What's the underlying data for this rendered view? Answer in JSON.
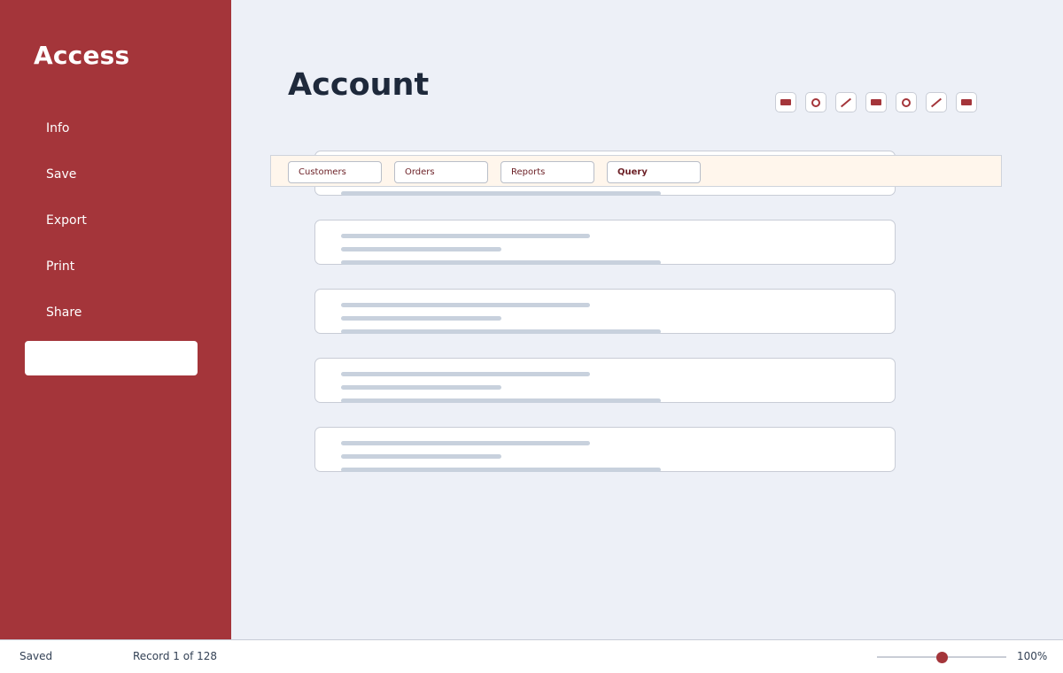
{
  "app": {
    "title": "Access"
  },
  "sidebar": {
    "items": [
      {
        "label": "Info"
      },
      {
        "label": "Save"
      },
      {
        "label": "Export"
      },
      {
        "label": "Print"
      },
      {
        "label": "Share"
      },
      {
        "label": ""
      }
    ],
    "selected_index": 5
  },
  "main": {
    "title": "Account"
  },
  "toolbar": {
    "tools": [
      {
        "icon": "rectangle-icon"
      },
      {
        "icon": "circle-icon"
      },
      {
        "icon": "line-icon"
      },
      {
        "icon": "rectangle-icon"
      },
      {
        "icon": "circle-icon"
      },
      {
        "icon": "line-icon"
      },
      {
        "icon": "rectangle-icon"
      }
    ]
  },
  "tabs": [
    {
      "label": "Customers"
    },
    {
      "label": "Orders"
    },
    {
      "label": "Reports"
    },
    {
      "label": "Query",
      "active": true
    }
  ],
  "status": {
    "state": "Saved",
    "record": "Record 1 of 128",
    "zoom_label": "100%",
    "zoom_fraction": 0.5
  },
  "colors": {
    "accent": "#a4353a",
    "background": "#edf0f7",
    "tabstrip": "#fff6ec"
  }
}
